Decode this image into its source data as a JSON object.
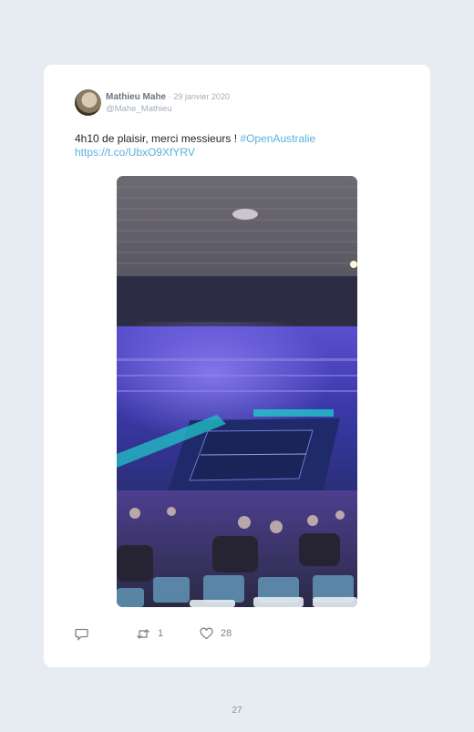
{
  "tweet": {
    "author_name": "Mathieu Mahe",
    "date": "· 29 janvier 2020",
    "handle": "@Mahe_Mathieu",
    "text": "4h10 de plaisir, merci messieurs ! ",
    "hashtag": "#OpenAustralie",
    "url": "https://t.co/UbxO9XfYRV",
    "media_alt": "tennis-arena-photo",
    "actions": {
      "reply_icon": "reply-icon",
      "retweet_icon": "retweet-icon",
      "retweet_count": "1",
      "like_icon": "heart-icon",
      "like_count": "28"
    }
  },
  "page": {
    "number": "27"
  },
  "colors": {
    "link": "#5ab0e0",
    "background": "#e7ebf2",
    "card": "#ffffff"
  }
}
